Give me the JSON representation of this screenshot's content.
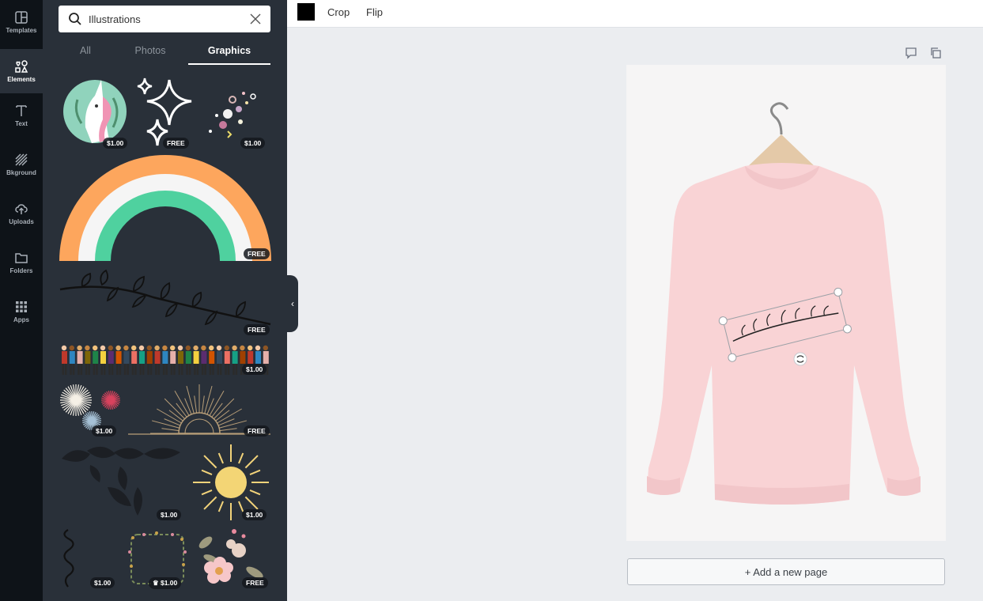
{
  "sidebar_rail": {
    "items": [
      {
        "label": "Templates",
        "icon": "templates-icon"
      },
      {
        "label": "Elements",
        "icon": "elements-icon",
        "active": true
      },
      {
        "label": "Text",
        "icon": "text-icon"
      },
      {
        "label": "Bkground",
        "icon": "background-icon"
      },
      {
        "label": "Uploads",
        "icon": "uploads-icon"
      },
      {
        "label": "Folders",
        "icon": "folders-icon"
      },
      {
        "label": "Apps",
        "icon": "apps-icon"
      }
    ]
  },
  "search": {
    "value": "Illustrations",
    "search_icon": "search-icon",
    "clear_icon": "close-icon"
  },
  "tabs": [
    {
      "label": "All"
    },
    {
      "label": "Photos"
    },
    {
      "label": "Graphics",
      "active": true
    }
  ],
  "graphics": [
    {
      "name": "unicorn-graphic",
      "price": "$1.00"
    },
    {
      "name": "sparkles-graphic",
      "price": "FREE"
    },
    {
      "name": "confetti-graphic",
      "price": "$1.00"
    },
    {
      "name": "rainbow-graphic",
      "price": "FREE"
    },
    {
      "name": "branch-graphic",
      "price": "FREE"
    },
    {
      "name": "people-crowd-graphic",
      "price": "$1.00"
    },
    {
      "name": "fireworks-graphic",
      "price": "$1.00"
    },
    {
      "name": "sunburst-graphic",
      "price": "FREE"
    },
    {
      "name": "leaves-graphic",
      "price": "$1.00"
    },
    {
      "name": "sun-graphic",
      "price": "$1.00"
    },
    {
      "name": "squiggle-graphic",
      "price": "$1.00"
    },
    {
      "name": "floral-frame-graphic",
      "price": "♛ $1.00"
    },
    {
      "name": "flowers-graphic",
      "price": "FREE"
    }
  ],
  "collapse_handle": "‹",
  "toolbar": {
    "color": "#000000",
    "crop_label": "Crop",
    "flip_label": "Flip"
  },
  "page_actions": {
    "notes_icon": "comment-icon",
    "duplicate_icon": "duplicate-icon"
  },
  "canvas": {
    "background": "#f6f5f5",
    "image": "pink-sweatshirt-on-hanger",
    "selected_element": "branch-graphic",
    "rotate_icon": "rotate-icon"
  },
  "add_page_label": "+ Add a new page",
  "colors": {
    "rail_bg": "#0e1318",
    "panel_bg": "#293039",
    "rainbow_orange": "#fda65d",
    "rainbow_white": "#f5f5f5",
    "rainbow_green": "#4fd19f",
    "sweatshirt": "#f9d3d5"
  }
}
